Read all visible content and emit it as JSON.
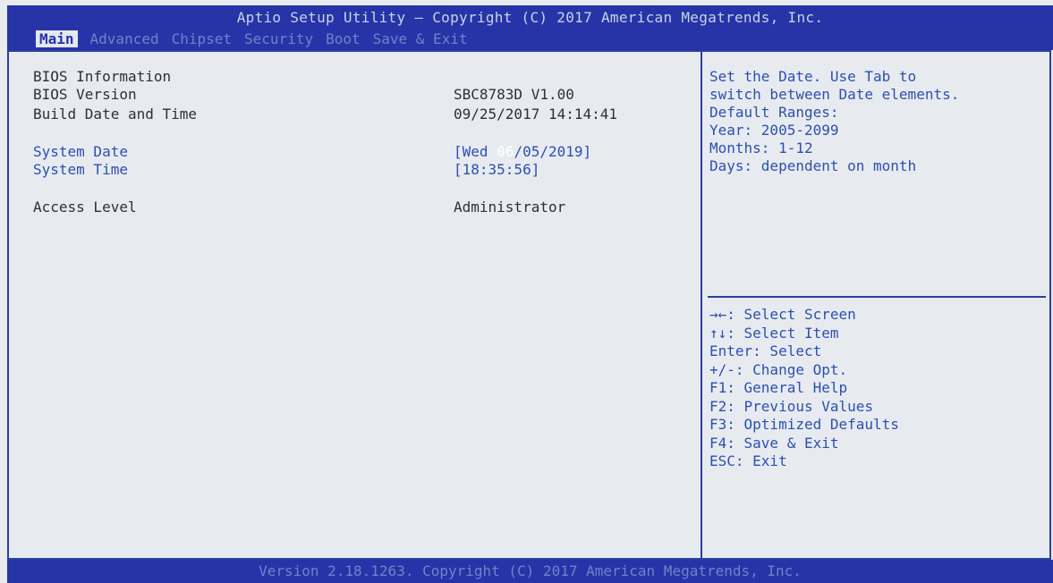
{
  "header": {
    "title": "Aptio Setup Utility – Copyright (C) 2017 American Megatrends, Inc.",
    "tabs": [
      "Main",
      "Advanced",
      "Chipset",
      "Security",
      "Boot",
      "Save & Exit"
    ]
  },
  "main": {
    "bios_info_label": "BIOS Information",
    "bios_version_label": "BIOS Version",
    "bios_version_value": "SBC8783D V1.00",
    "build_date_label": "Build Date and Time",
    "build_date_value": "09/25/2017 14:14:41",
    "system_date_label": "System Date",
    "system_date_prefix": "[Wed ",
    "system_date_month": "06",
    "system_date_rest": "/05/2019]",
    "system_time_label": "System Time",
    "system_time_value": "[18:35:56]",
    "access_level_label": "Access Level",
    "access_level_value": "Administrator"
  },
  "help": {
    "lines": [
      "Set the Date. Use Tab to",
      "switch between Date elements.",
      "Default Ranges:",
      "Year: 2005-2099",
      "Months: 1-12",
      "Days: dependent on month"
    ],
    "keys": [
      "→←: Select Screen",
      "↑↓: Select Item",
      "Enter: Select",
      "+/-: Change Opt.",
      "F1: General Help",
      "F2: Previous Values",
      "F3: Optimized Defaults",
      "F4: Save & Exit",
      "ESC: Exit"
    ]
  },
  "footer": {
    "text": "Version 2.18.1263. Copyright (C) 2017 American Megatrends, Inc."
  },
  "colors": {
    "bar": "#2634a8",
    "panel": "#e7ebf0",
    "accent_text": "#2d4fb0"
  }
}
